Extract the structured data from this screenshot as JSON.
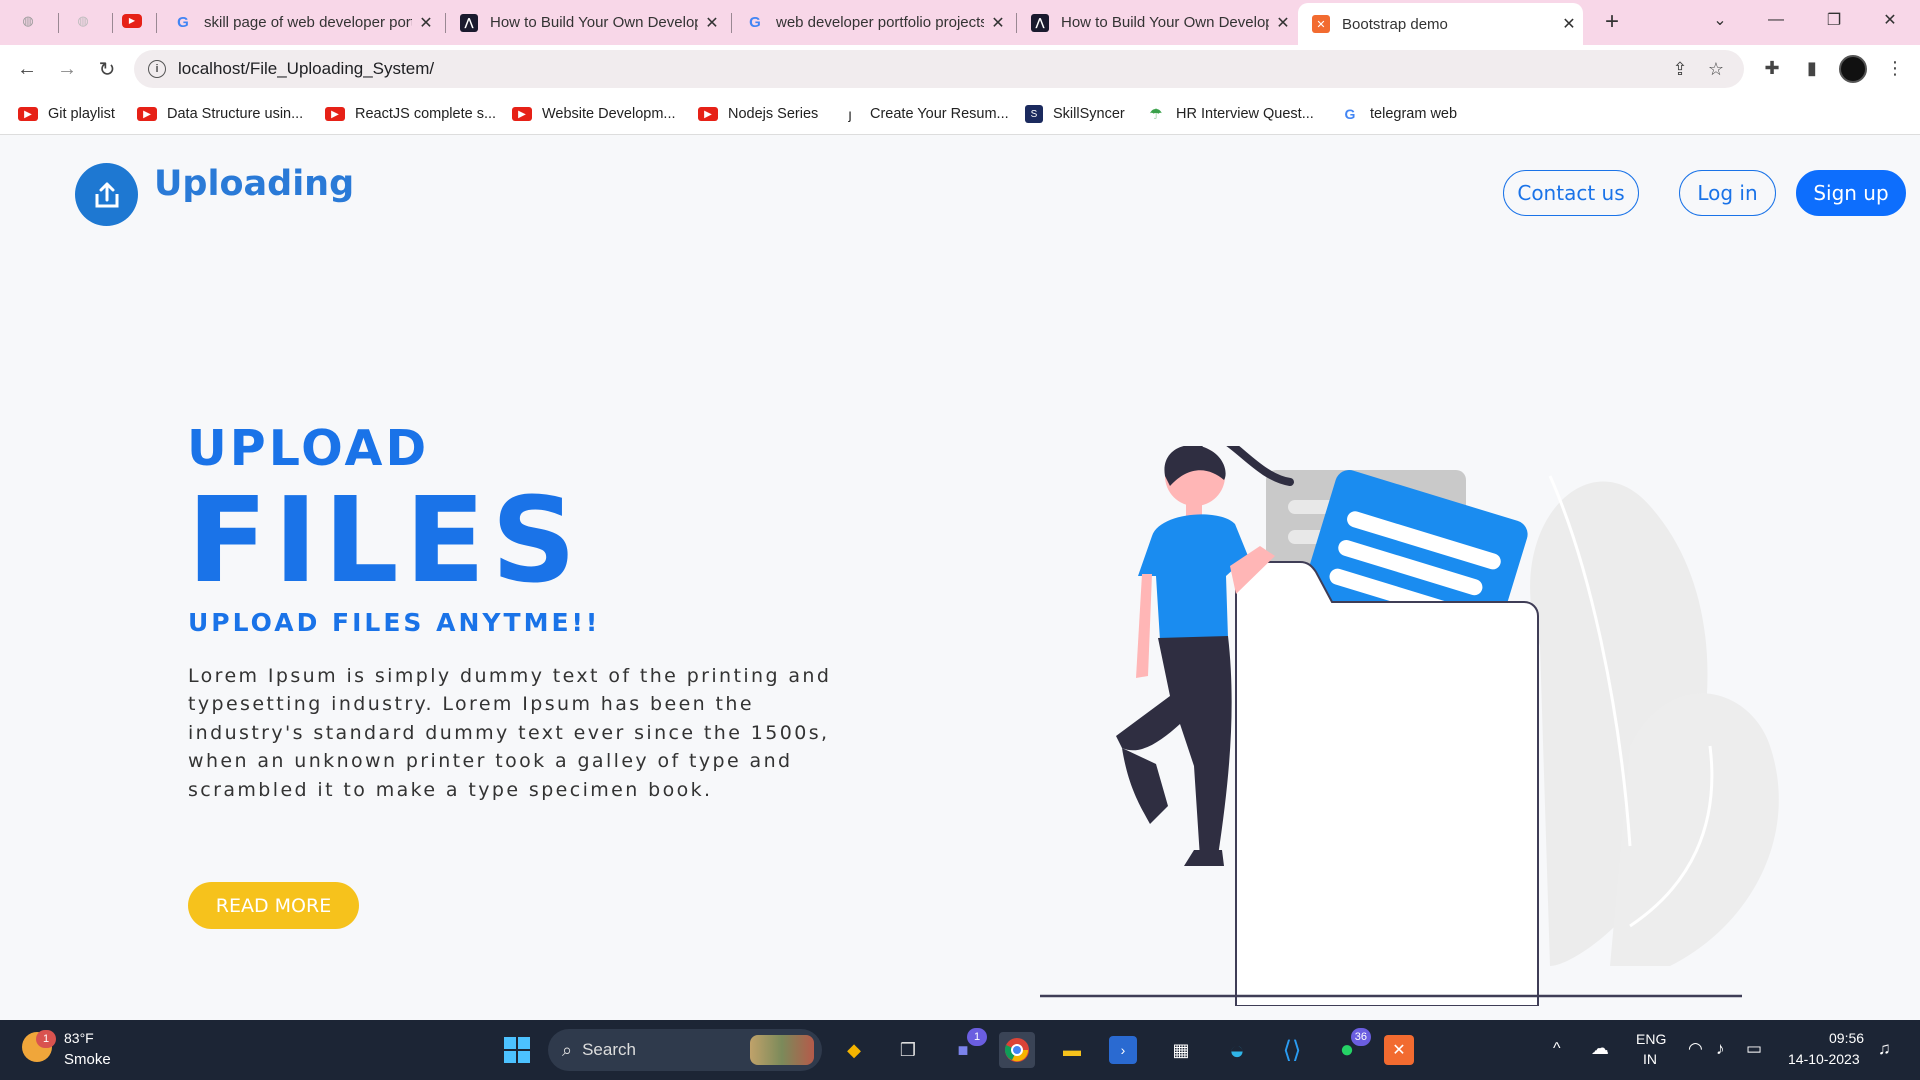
{
  "browser": {
    "tabs": [
      {
        "title": "skill page of web developer portfolio",
        "favicon": "google-icon"
      },
      {
        "title": "How to Build Your Own Developer Portfolio",
        "favicon": "dev-icon"
      },
      {
        "title": "web developer portfolio projects",
        "favicon": "google-icon"
      },
      {
        "title": "How to Build Your Own Developer Portfolio",
        "favicon": "dev-icon"
      },
      {
        "title": "Bootstrap demo",
        "favicon": "xampp-icon",
        "active": true
      }
    ],
    "close_glyph": "✕",
    "new_tab_glyph": "+",
    "url": "localhost/File_Uploading_System/",
    "bookmarks": [
      {
        "label": "Git playlist",
        "icon": "youtube-icon"
      },
      {
        "label": "Data Structure usin...",
        "icon": "youtube-icon"
      },
      {
        "label": "ReactJS complete s...",
        "icon": "youtube-icon"
      },
      {
        "label": "Website Developm...",
        "icon": "youtube-icon"
      },
      {
        "label": "Nodejs Series",
        "icon": "youtube-icon"
      },
      {
        "label": "Create Your Resum...",
        "icon": "resume-icon"
      },
      {
        "label": "SkillSyncer",
        "icon": "skillsyncer-icon"
      },
      {
        "label": "HR Interview Quest...",
        "icon": "umbrella-icon"
      },
      {
        "label": "telegram web",
        "icon": "google-icon"
      }
    ]
  },
  "site": {
    "brand": "Uploading",
    "nav": {
      "contact": "Contact us",
      "login": "Log in",
      "signup": "Sign up"
    },
    "hero": {
      "line1": "UPLOAD",
      "line2": "FILES",
      "subtitle": "UPLOAD FILES ANYTME!!",
      "body": "Lorem Ipsum is simply dummy text of the printing and typesetting industry. Lorem Ipsum has been the industry's standard dummy text ever since the 1500s, when an unknown printer took a galley of type and scrambled it to make a type specimen book.",
      "cta": "READ MORE"
    },
    "colors": {
      "accent": "#1a73e8",
      "cta": "#f6c21c"
    }
  },
  "taskbar": {
    "weather_temp": "83°F",
    "weather_desc": "Smoke",
    "weather_badge": "1",
    "search_label": "Search",
    "teams_badge": "1",
    "whatsapp_badge": "36",
    "lang1": "ENG",
    "lang2": "IN",
    "time": "09:56",
    "date": "14-10-2023"
  }
}
